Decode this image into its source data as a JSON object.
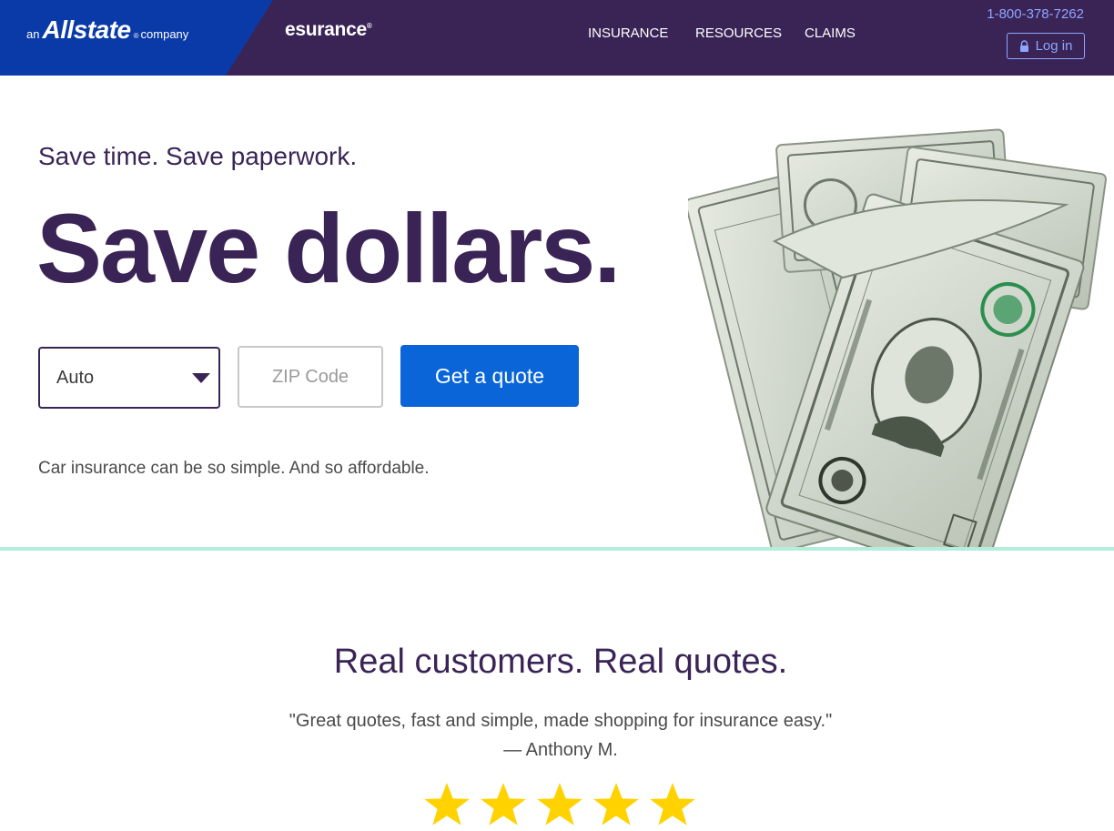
{
  "header": {
    "allstate": {
      "prefix": "an",
      "name": "Allstate",
      "reg": "®",
      "suffix": "company"
    },
    "esurance": {
      "name": "esurance",
      "reg": "®"
    },
    "nav": [
      "INSURANCE",
      "RESOURCES",
      "CLAIMS"
    ],
    "phone": "1-800-378-7262",
    "login_label": "Log in",
    "icons": {
      "login": "lock-icon"
    }
  },
  "hero": {
    "tagline": "Save time. Save paperwork.",
    "headline": "Save dollars.",
    "insurance_select": "Auto",
    "zip_placeholder": "ZIP Code",
    "cta": "Get a quote",
    "subcopy": "Car insurance can be so simple. And so affordable.",
    "image": "dollar-bills"
  },
  "reviews": {
    "title": "Real customers. Real quotes.",
    "quote": "\"Great quotes, fast and simple, made shopping for insurance easy.\"",
    "author": "— Anthony M.",
    "rating": 5
  },
  "colors": {
    "header_bg": "#3a2456",
    "allstate_blue": "#0a3aa8",
    "accent_blue": "#0a66d8",
    "link_blue": "#8ea6ff",
    "divider_mint": "#b2eedb",
    "star_yellow": "#ffd200"
  }
}
